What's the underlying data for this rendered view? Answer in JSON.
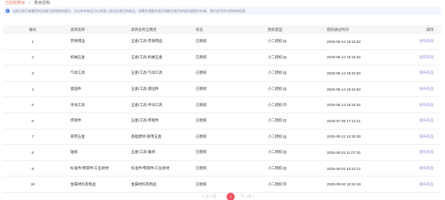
{
  "breadcrumb": {
    "parent": "已授权类目",
    "separator": ">",
    "current": "类目授权"
  },
  "notice": {
    "icon": "info-icon",
    "text": "当前页面可查看您的店铺已经授权的类目，点击发布商品可以快速上架对应类目的商品，如需开通更多类目请前往类目申请页面提交申请，我们会尽快为您审核处理"
  },
  "table": {
    "headers": [
      "编号",
      "类目名称",
      "类目名称全路径",
      "状态",
      "授权类型",
      "授权通过时间",
      "操作"
    ],
    "rows": [
      {
        "no": "1",
        "name": "劳保用品",
        "path": "五金/工具-劳保用品",
        "status": "已授权",
        "type": "小二授权",
        "time": "2025-06-14 15:34:52",
        "op": "发布商品"
      },
      {
        "no": "2",
        "name": "机械五金",
        "path": "五金/工具-机械五金",
        "status": "已授权",
        "type": "小二授权",
        "time": "2025-06-14 15:34:52",
        "op": "发布商品"
      },
      {
        "no": "3",
        "name": "气动工具",
        "path": "五金/工具-气动工具",
        "status": "已授权",
        "type": "小二授权",
        "time": "2025-06-14 15:34:52",
        "op": "发布商品"
      },
      {
        "no": "4",
        "name": "紧固件",
        "path": "五金/工具-紧固件",
        "status": "已授权",
        "type": "小二授权",
        "time": "2025-06-14 15:34:52",
        "op": "发布商品"
      },
      {
        "no": "5",
        "name": "手动工具",
        "path": "五金/工具-手动工具",
        "status": "已授权",
        "type": "小二授权",
        "time": "2025-06-14 15:34:52",
        "op": "发布商品"
      },
      {
        "no": "6",
        "name": "焊接件",
        "path": "五金/工具-焊接件",
        "status": "已授权",
        "type": "小二授权",
        "time": "2025-07-29 17:12:21",
        "op": "发布商品"
      },
      {
        "no": "7",
        "name": "家用五金",
        "path": "基础建材-家用五金",
        "status": "已授权",
        "type": "小二授权",
        "time": "2025-08-12 14:25:38",
        "op": "发布商品"
      },
      {
        "no": "8",
        "name": "轴承",
        "path": "五金/工具-轴承",
        "status": "已授权",
        "type": "小二授权",
        "time": "2025-08-22 11:07:30",
        "op": "发布商品"
      },
      {
        "no": "9",
        "name": "标准件/零部件/工业耗材",
        "path": "标准件/零部件/工业耗材",
        "status": "已授权",
        "type": "小二授权",
        "time": "2025-09-02 10:23:12",
        "op": "发布商品"
      },
      {
        "no": "10",
        "name": "金属材料及制品",
        "path": "金属材料及制品",
        "status": "已授权",
        "type": "小二授权",
        "time": "2025-09-02 10:24:49",
        "op": "发布商品"
      }
    ]
  },
  "pager": {
    "prev": "< 上一页",
    "current": "1",
    "next": "下一页 >"
  }
}
